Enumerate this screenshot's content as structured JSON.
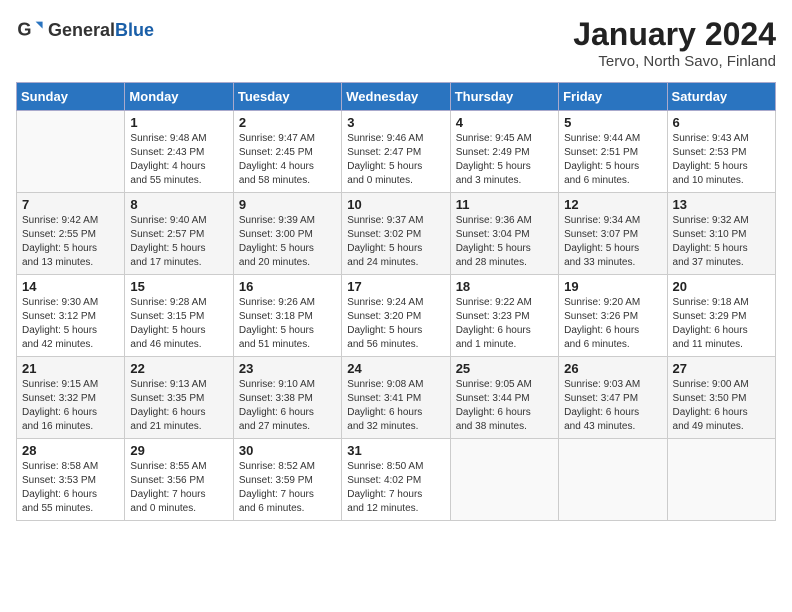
{
  "header": {
    "logo_general": "General",
    "logo_blue": "Blue",
    "month_year": "January 2024",
    "location": "Tervo, North Savo, Finland"
  },
  "days_of_week": [
    "Sunday",
    "Monday",
    "Tuesday",
    "Wednesday",
    "Thursday",
    "Friday",
    "Saturday"
  ],
  "weeks": [
    [
      {
        "day": "",
        "info": ""
      },
      {
        "day": "1",
        "info": "Sunrise: 9:48 AM\nSunset: 2:43 PM\nDaylight: 4 hours\nand 55 minutes."
      },
      {
        "day": "2",
        "info": "Sunrise: 9:47 AM\nSunset: 2:45 PM\nDaylight: 4 hours\nand 58 minutes."
      },
      {
        "day": "3",
        "info": "Sunrise: 9:46 AM\nSunset: 2:47 PM\nDaylight: 5 hours\nand 0 minutes."
      },
      {
        "day": "4",
        "info": "Sunrise: 9:45 AM\nSunset: 2:49 PM\nDaylight: 5 hours\nand 3 minutes."
      },
      {
        "day": "5",
        "info": "Sunrise: 9:44 AM\nSunset: 2:51 PM\nDaylight: 5 hours\nand 6 minutes."
      },
      {
        "day": "6",
        "info": "Sunrise: 9:43 AM\nSunset: 2:53 PM\nDaylight: 5 hours\nand 10 minutes."
      }
    ],
    [
      {
        "day": "7",
        "info": "Sunrise: 9:42 AM\nSunset: 2:55 PM\nDaylight: 5 hours\nand 13 minutes."
      },
      {
        "day": "8",
        "info": "Sunrise: 9:40 AM\nSunset: 2:57 PM\nDaylight: 5 hours\nand 17 minutes."
      },
      {
        "day": "9",
        "info": "Sunrise: 9:39 AM\nSunset: 3:00 PM\nDaylight: 5 hours\nand 20 minutes."
      },
      {
        "day": "10",
        "info": "Sunrise: 9:37 AM\nSunset: 3:02 PM\nDaylight: 5 hours\nand 24 minutes."
      },
      {
        "day": "11",
        "info": "Sunrise: 9:36 AM\nSunset: 3:04 PM\nDaylight: 5 hours\nand 28 minutes."
      },
      {
        "day": "12",
        "info": "Sunrise: 9:34 AM\nSunset: 3:07 PM\nDaylight: 5 hours\nand 33 minutes."
      },
      {
        "day": "13",
        "info": "Sunrise: 9:32 AM\nSunset: 3:10 PM\nDaylight: 5 hours\nand 37 minutes."
      }
    ],
    [
      {
        "day": "14",
        "info": "Sunrise: 9:30 AM\nSunset: 3:12 PM\nDaylight: 5 hours\nand 42 minutes."
      },
      {
        "day": "15",
        "info": "Sunrise: 9:28 AM\nSunset: 3:15 PM\nDaylight: 5 hours\nand 46 minutes."
      },
      {
        "day": "16",
        "info": "Sunrise: 9:26 AM\nSunset: 3:18 PM\nDaylight: 5 hours\nand 51 minutes."
      },
      {
        "day": "17",
        "info": "Sunrise: 9:24 AM\nSunset: 3:20 PM\nDaylight: 5 hours\nand 56 minutes."
      },
      {
        "day": "18",
        "info": "Sunrise: 9:22 AM\nSunset: 3:23 PM\nDaylight: 6 hours\nand 1 minute."
      },
      {
        "day": "19",
        "info": "Sunrise: 9:20 AM\nSunset: 3:26 PM\nDaylight: 6 hours\nand 6 minutes."
      },
      {
        "day": "20",
        "info": "Sunrise: 9:18 AM\nSunset: 3:29 PM\nDaylight: 6 hours\nand 11 minutes."
      }
    ],
    [
      {
        "day": "21",
        "info": "Sunrise: 9:15 AM\nSunset: 3:32 PM\nDaylight: 6 hours\nand 16 minutes."
      },
      {
        "day": "22",
        "info": "Sunrise: 9:13 AM\nSunset: 3:35 PM\nDaylight: 6 hours\nand 21 minutes."
      },
      {
        "day": "23",
        "info": "Sunrise: 9:10 AM\nSunset: 3:38 PM\nDaylight: 6 hours\nand 27 minutes."
      },
      {
        "day": "24",
        "info": "Sunrise: 9:08 AM\nSunset: 3:41 PM\nDaylight: 6 hours\nand 32 minutes."
      },
      {
        "day": "25",
        "info": "Sunrise: 9:05 AM\nSunset: 3:44 PM\nDaylight: 6 hours\nand 38 minutes."
      },
      {
        "day": "26",
        "info": "Sunrise: 9:03 AM\nSunset: 3:47 PM\nDaylight: 6 hours\nand 43 minutes."
      },
      {
        "day": "27",
        "info": "Sunrise: 9:00 AM\nSunset: 3:50 PM\nDaylight: 6 hours\nand 49 minutes."
      }
    ],
    [
      {
        "day": "28",
        "info": "Sunrise: 8:58 AM\nSunset: 3:53 PM\nDaylight: 6 hours\nand 55 minutes."
      },
      {
        "day": "29",
        "info": "Sunrise: 8:55 AM\nSunset: 3:56 PM\nDaylight: 7 hours\nand 0 minutes."
      },
      {
        "day": "30",
        "info": "Sunrise: 8:52 AM\nSunset: 3:59 PM\nDaylight: 7 hours\nand 6 minutes."
      },
      {
        "day": "31",
        "info": "Sunrise: 8:50 AM\nSunset: 4:02 PM\nDaylight: 7 hours\nand 12 minutes."
      },
      {
        "day": "",
        "info": ""
      },
      {
        "day": "",
        "info": ""
      },
      {
        "day": "",
        "info": ""
      }
    ]
  ]
}
